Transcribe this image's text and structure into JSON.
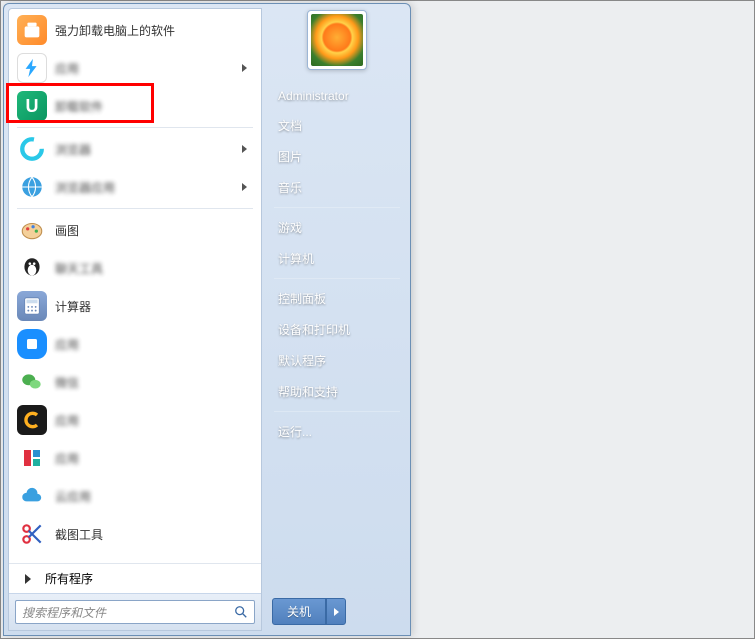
{
  "left_panel": {
    "programs": [
      {
        "label": "强力卸载电脑上的软件",
        "blurred": false,
        "flyout": false,
        "icon": "ico-orange"
      },
      {
        "label": "应用",
        "blurred": true,
        "flyout": true,
        "icon": "ico-blue-bolt"
      },
      {
        "label": "卸载软件",
        "blurred": true,
        "flyout": false,
        "icon": "ico-green-u"
      },
      {
        "label": "浏览器",
        "blurred": true,
        "flyout": true,
        "icon": "ico-cyan-c"
      },
      {
        "label": "浏览器应用",
        "blurred": true,
        "flyout": true,
        "icon": "ico-globe"
      },
      {
        "label": "画图",
        "blurred": false,
        "flyout": false,
        "icon": "ico-paint"
      },
      {
        "label": "聊天工具",
        "blurred": true,
        "flyout": false,
        "icon": "ico-qq"
      },
      {
        "label": "计算器",
        "blurred": false,
        "flyout": false,
        "icon": "ico-calc"
      },
      {
        "label": "应用",
        "blurred": true,
        "flyout": false,
        "icon": "ico-blue-sq"
      },
      {
        "label": "微信",
        "blurred": true,
        "flyout": false,
        "icon": "ico-wechat"
      },
      {
        "label": "应用",
        "blurred": true,
        "flyout": false,
        "icon": "ico-black-c"
      },
      {
        "label": "应用",
        "blurred": true,
        "flyout": false,
        "icon": "ico-red-l"
      },
      {
        "label": "云应用",
        "blurred": true,
        "flyout": false,
        "icon": "ico-cloud"
      },
      {
        "label": "截图工具",
        "blurred": false,
        "flyout": false,
        "icon": "ico-snip"
      }
    ],
    "all_programs": "所有程序",
    "search_placeholder": "搜索程序和文件"
  },
  "right_panel": {
    "user": "Administrator",
    "items_group1": [
      "文档",
      "图片",
      "音乐"
    ],
    "items_group2": [
      "游戏",
      "计算机"
    ],
    "items_group3": [
      "控制面板",
      "设备和打印机",
      "默认程序",
      "帮助和支持"
    ],
    "items_group4": [
      "运行..."
    ],
    "shutdown": "关机"
  },
  "highlighted_index": 2
}
